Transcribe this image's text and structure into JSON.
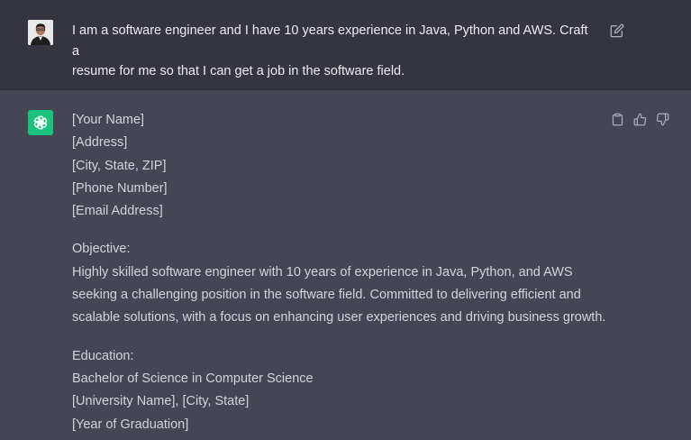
{
  "user_message": {
    "lines": [
      "I am a software engineer and I have 10 years experience in Java, Python and AWS. Craft a",
      "resume for me so that I can get a job in the software field."
    ],
    "edit_icon": "edit-icon"
  },
  "assistant_message": {
    "header_lines": [
      "[Your Name]",
      "[Address]",
      "[City, State, ZIP]",
      "[Phone Number]",
      "[Email Address]"
    ],
    "objective": {
      "heading": "Objective:",
      "lines": [
        "Highly skilled software engineer with 10 years of experience in Java, Python, and AWS",
        "seeking a challenging position in the software field. Committed to delivering efficient and",
        "scalable solutions, with a focus on enhancing user experiences and driving business growth."
      ]
    },
    "education": {
      "heading": "Education:",
      "lines": [
        "Bachelor of Science in Computer Science",
        "[University Name], [City, State]",
        "[Year of Graduation]"
      ]
    },
    "actions": [
      "copy-icon",
      "thumbs-up-icon",
      "thumbs-down-icon"
    ]
  },
  "colors": {
    "user_bg": "#343541",
    "assistant_bg": "#444654",
    "bot_avatar": "#19c37d",
    "text": "#d1d5db"
  }
}
